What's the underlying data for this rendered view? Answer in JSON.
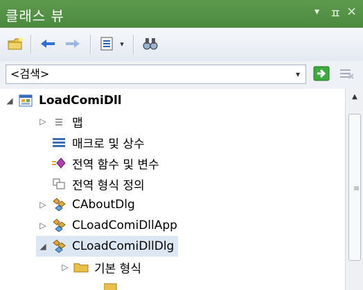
{
  "title_bar": {
    "title": "클래스 뷰",
    "dropdown_glyph": "▾",
    "pin_glyph": "ㅍ",
    "close_glyph": "×"
  },
  "toolbar": {
    "icons": [
      "new-folder-icon",
      "back-arrow-icon",
      "forward-arrow-icon",
      "settings-list-icon",
      "dropdown-arrow-icon",
      "binoculars-icon"
    ]
  },
  "search": {
    "value": "<검색>",
    "dropdown_glyph": "▾"
  },
  "tree": {
    "items": [
      {
        "label": "LoadComiDll",
        "expander": "◢",
        "icon": "project-icon"
      },
      {
        "label": "맵",
        "expander": "▷",
        "icon": "map-icon"
      },
      {
        "label": "매크로 및 상수",
        "expander": "",
        "icon": "macro-icon"
      },
      {
        "label": "전역 함수 및 변수",
        "expander": "",
        "icon": "global-function-icon"
      },
      {
        "label": "전역 형식 정의",
        "expander": "",
        "icon": "typedef-icon"
      },
      {
        "label": "CAboutDlg",
        "expander": "▷",
        "icon": "class-icon"
      },
      {
        "label": "CLoadComiDllApp",
        "expander": "▷",
        "icon": "class-icon"
      },
      {
        "label": "CLoadComiDllDlg",
        "expander": "◢",
        "icon": "class-icon"
      },
      {
        "label": "기본 형식",
        "expander": "▷",
        "icon": "folder-icon"
      }
    ]
  },
  "colors": {
    "title_bg": "#4b8a3f",
    "selection_bg": "#dde7f4"
  }
}
